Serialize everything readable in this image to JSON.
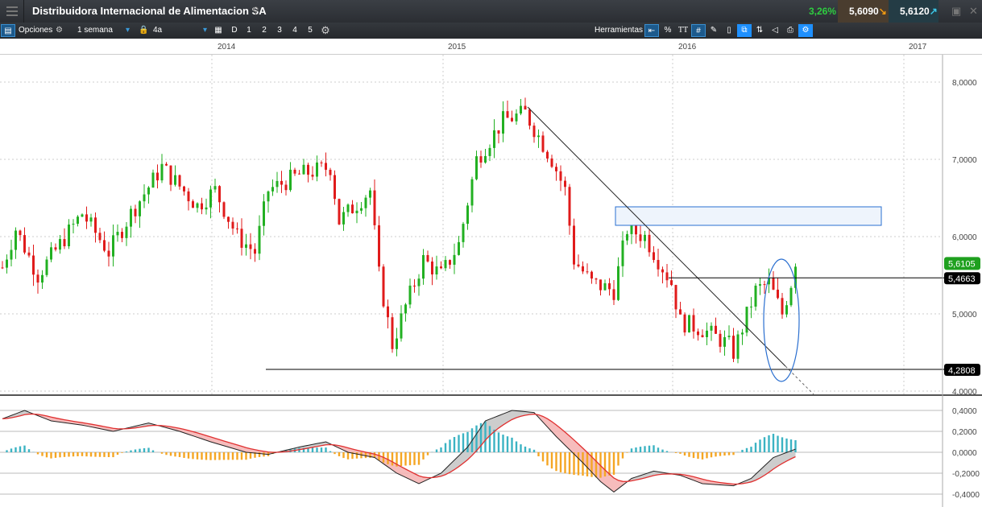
{
  "header": {
    "title": "Distribuidora Internacional de Alimentacion SA",
    "change_pct": "3,26%",
    "bid": "5,6090",
    "ask": "5,6120",
    "bid_arrow": "down-arrow-icon",
    "ask_arrow": "up-arrow-icon"
  },
  "toolbar": {
    "options_label": "Opciones",
    "period": "1 semana",
    "range": "4a",
    "buttons": [
      "D",
      "1",
      "2",
      "3",
      "4",
      "5"
    ],
    "tools_label": "Herramientas",
    "percent": "%",
    "text_tool": "TT"
  },
  "colors": {
    "up": "#22b022",
    "down": "#e01b1b",
    "macd_hist_pos": "#3bb3c3",
    "macd_hist_neg": "#f5a623",
    "signal": "#e03030",
    "rect_fill": "#eef4fc",
    "rect_stroke": "#2a6fd0"
  },
  "xaxis": {
    "labels": [
      "2014",
      "2015",
      "2016",
      "2017"
    ]
  },
  "yaxis": {
    "labels": [
      "8,0000",
      "7,0000",
      "6,0000",
      "5,0000",
      "4,0000"
    ],
    "values": [
      8,
      7,
      6,
      5,
      4
    ]
  },
  "price_tags": {
    "last": "5,6105",
    "resistance": "5,4663",
    "support": "4,2808"
  },
  "levels": {
    "resistance": 5.4663,
    "support": 4.2808,
    "last": 5.6105
  },
  "macd": {
    "labels": [
      "0,4000",
      "0,2000",
      "0,0000",
      "-0,2000",
      "-0,4000"
    ],
    "values": [
      0.4,
      0.2,
      0,
      -0.2,
      -0.4
    ]
  },
  "chart_data": {
    "type": "candlestick",
    "price_path": [
      [
        0,
        5.6
      ],
      [
        3,
        6.1
      ],
      [
        8,
        5.5
      ],
      [
        13,
        5.9
      ],
      [
        18,
        6.3
      ],
      [
        24,
        5.8
      ],
      [
        29,
        6.3
      ],
      [
        36,
        6.9
      ],
      [
        44,
        6.4
      ],
      [
        48,
        6.6
      ],
      [
        53,
        6.0
      ],
      [
        57,
        5.8
      ],
      [
        60,
        6.6
      ],
      [
        67,
        6.8
      ],
      [
        74,
        6.9
      ],
      [
        76,
        6.2
      ],
      [
        83,
        6.6
      ],
      [
        85,
        5.5
      ],
      [
        88,
        4.6
      ],
      [
        91,
        5.1
      ],
      [
        95,
        5.7
      ],
      [
        99,
        5.5
      ],
      [
        103,
        5.9
      ],
      [
        107,
        7.0
      ],
      [
        113,
        7.5
      ],
      [
        118,
        7.6
      ],
      [
        124,
        7.0
      ],
      [
        127,
        6.6
      ],
      [
        129,
        5.7
      ],
      [
        133,
        5.4
      ],
      [
        138,
        5.3
      ],
      [
        141,
        6.1
      ],
      [
        145,
        6.0
      ],
      [
        151,
        5.4
      ],
      [
        153,
        4.9
      ],
      [
        158,
        4.8
      ],
      [
        164,
        4.6
      ],
      [
        165,
        4.5
      ],
      [
        170,
        5.3
      ],
      [
        173,
        5.4
      ],
      [
        176,
        5.0
      ],
      [
        179,
        5.6
      ]
    ],
    "macd_path": [
      [
        0,
        0.32
      ],
      [
        5,
        0.4
      ],
      [
        11,
        0.3
      ],
      [
        18,
        0.26
      ],
      [
        25,
        0.2
      ],
      [
        33,
        0.28
      ],
      [
        40,
        0.2
      ],
      [
        47,
        0.1
      ],
      [
        55,
        0.0
      ],
      [
        60,
        -0.02
      ],
      [
        67,
        0.05
      ],
      [
        73,
        0.1
      ],
      [
        78,
        0.0
      ],
      [
        84,
        -0.05
      ],
      [
        89,
        -0.2
      ],
      [
        94,
        -0.3
      ],
      [
        99,
        -0.2
      ],
      [
        105,
        0.05
      ],
      [
        109,
        0.3
      ],
      [
        115,
        0.4
      ],
      [
        120,
        0.38
      ],
      [
        125,
        0.15
      ],
      [
        131,
        -0.1
      ],
      [
        135,
        -0.28
      ],
      [
        138,
        -0.38
      ],
      [
        142,
        -0.25
      ],
      [
        147,
        -0.18
      ],
      [
        153,
        -0.22
      ],
      [
        158,
        -0.3
      ],
      [
        165,
        -0.32
      ],
      [
        169,
        -0.25
      ],
      [
        174,
        -0.05
      ],
      [
        179,
        0.03
      ]
    ]
  }
}
